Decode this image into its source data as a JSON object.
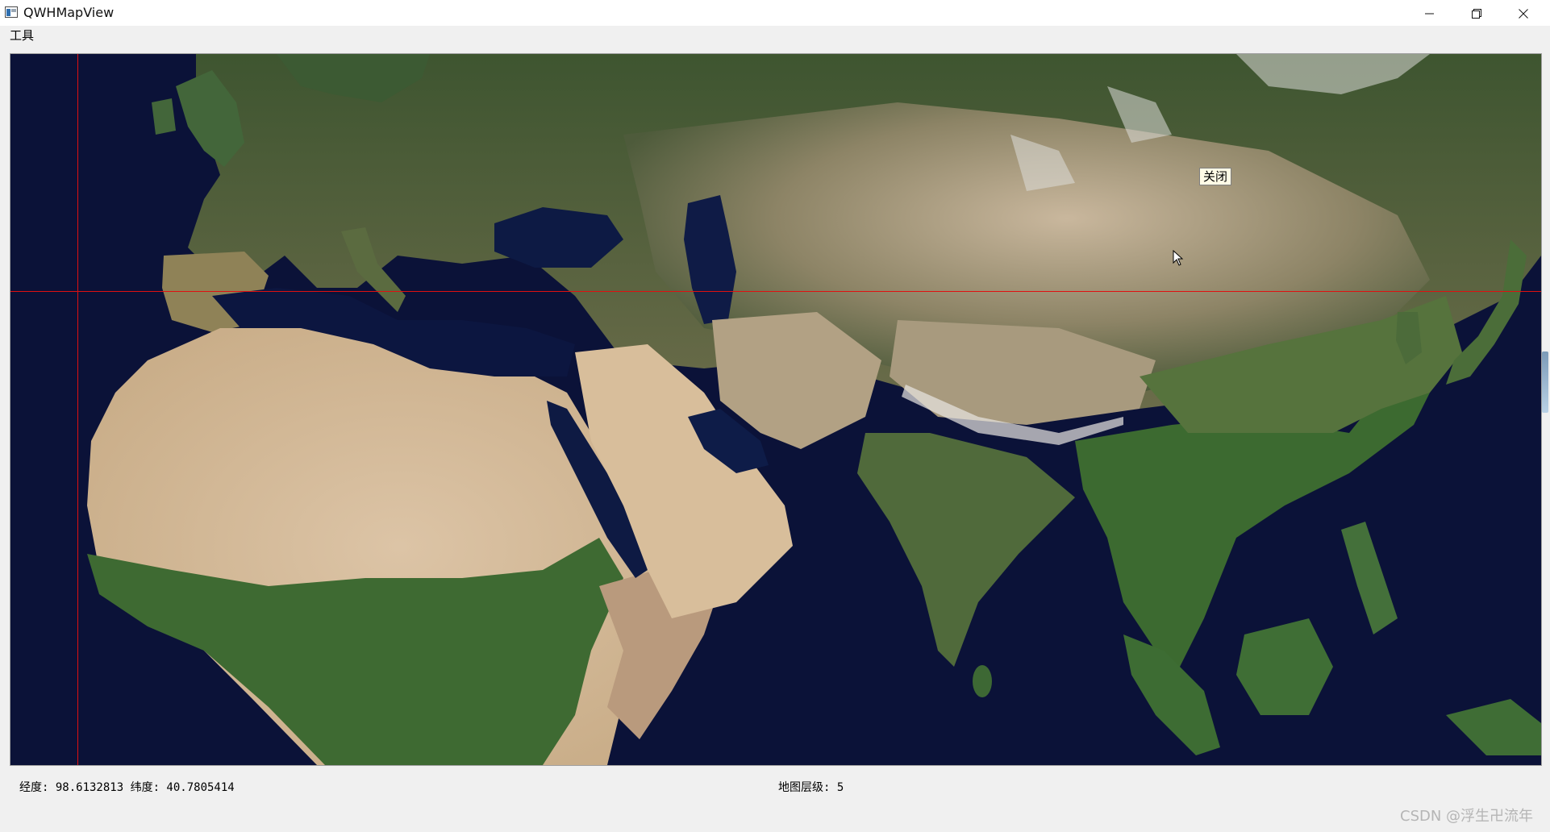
{
  "window": {
    "title": "QWHMapView",
    "icon": "app-window-icon",
    "controls": [
      "minimize-icon",
      "maximize-icon",
      "close-icon"
    ]
  },
  "menu": {
    "items": [
      "工具"
    ]
  },
  "map": {
    "popup_label": "关闭",
    "colors": {
      "ocean": "#0b1238",
      "crosshair": "#e01010",
      "desert": "#d6bd9c",
      "forest": "#3f6a34"
    }
  },
  "status": {
    "coords": "经度: 98.6132813  纬度: 40.7805414",
    "zoom": "地图层级: 5"
  },
  "watermark": "CSDN @浮生卍流年"
}
